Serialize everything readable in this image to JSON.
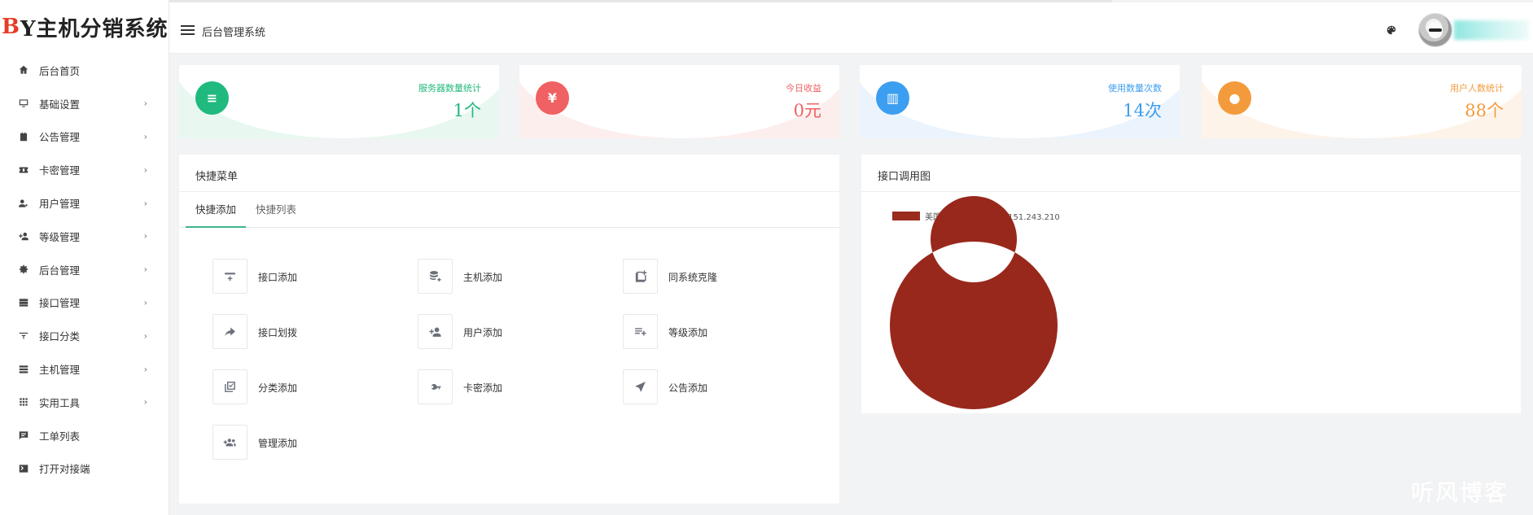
{
  "app": {
    "logo_prefix": "B",
    "logo_text": "Y主机分销系统",
    "header_title": "后台管理系统"
  },
  "sidebar": {
    "items": [
      {
        "label": "后台首页",
        "icon": "home-icon",
        "arrow": false
      },
      {
        "label": "基础设置",
        "icon": "monitor-icon",
        "arrow": true
      },
      {
        "label": "公告管理",
        "icon": "clipboard-icon",
        "arrow": true
      },
      {
        "label": "卡密管理",
        "icon": "ticket-icon",
        "arrow": true
      },
      {
        "label": "用户管理",
        "icon": "user-gear-icon",
        "arrow": true
      },
      {
        "label": "等级管理",
        "icon": "user-add-icon",
        "arrow": true
      },
      {
        "label": "后台管理",
        "icon": "gear-icon",
        "arrow": true
      },
      {
        "label": "接口管理",
        "icon": "server-icon",
        "arrow": true
      },
      {
        "label": "接口分类",
        "icon": "filter-icon",
        "arrow": true
      },
      {
        "label": "主机管理",
        "icon": "storage-icon",
        "arrow": true
      },
      {
        "label": "实用工具",
        "icon": "grid-icon",
        "arrow": true
      },
      {
        "label": "工单列表",
        "icon": "message-icon",
        "arrow": false
      },
      {
        "label": "打开对接端",
        "icon": "terminal-icon",
        "arrow": false
      }
    ],
    "arrow_glyph": "›"
  },
  "stats": [
    {
      "label": "服务器数量统计",
      "value": "1个",
      "color": "#20b97e",
      "bg": "#e8f8f0",
      "icon": "database-icon",
      "glyph": "≡"
    },
    {
      "label": "今日收益",
      "value": "0元",
      "color": "#ef6162",
      "bg": "#fdeeee",
      "icon": "yen-icon",
      "glyph": "¥"
    },
    {
      "label": "使用数量次数",
      "value": "14次",
      "color": "#3c9ef0",
      "bg": "#ebf4fd",
      "icon": "bar-chart-icon",
      "glyph": "▥"
    },
    {
      "label": "用户人数统计",
      "value": "88个",
      "color": "#f39b3c",
      "bg": "#fdf3e8",
      "icon": "person-icon",
      "glyph": "●"
    }
  ],
  "quick_menu": {
    "title": "快捷菜单",
    "tabs": [
      "快捷添加",
      "快捷列表"
    ],
    "items": [
      {
        "label": "接口添加",
        "icon": "interface-add-icon"
      },
      {
        "label": "主机添加",
        "icon": "database-add-icon"
      },
      {
        "label": "同系统克隆",
        "icon": "clone-icon"
      },
      {
        "label": "接口划拨",
        "icon": "share-arrow-icon"
      },
      {
        "label": "用户添加",
        "icon": "person-add-icon"
      },
      {
        "label": "等级添加",
        "icon": "playlist-add-icon"
      },
      {
        "label": "分类添加",
        "icon": "library-check-icon"
      },
      {
        "label": "卡密添加",
        "icon": "key-icon"
      },
      {
        "label": "公告添加",
        "icon": "send-icon"
      },
      {
        "label": "管理添加",
        "icon": "group-add-icon"
      }
    ]
  },
  "chart_panel": {
    "title": "接口调用图"
  },
  "chart_data": {
    "type": "pie",
    "donut": true,
    "labels": [
      "美国高防1区[EP]:192.151.243.210"
    ],
    "values": [
      100
    ],
    "colors": [
      "#99281c"
    ],
    "legend": "top-left"
  },
  "watermark": "听风博客"
}
